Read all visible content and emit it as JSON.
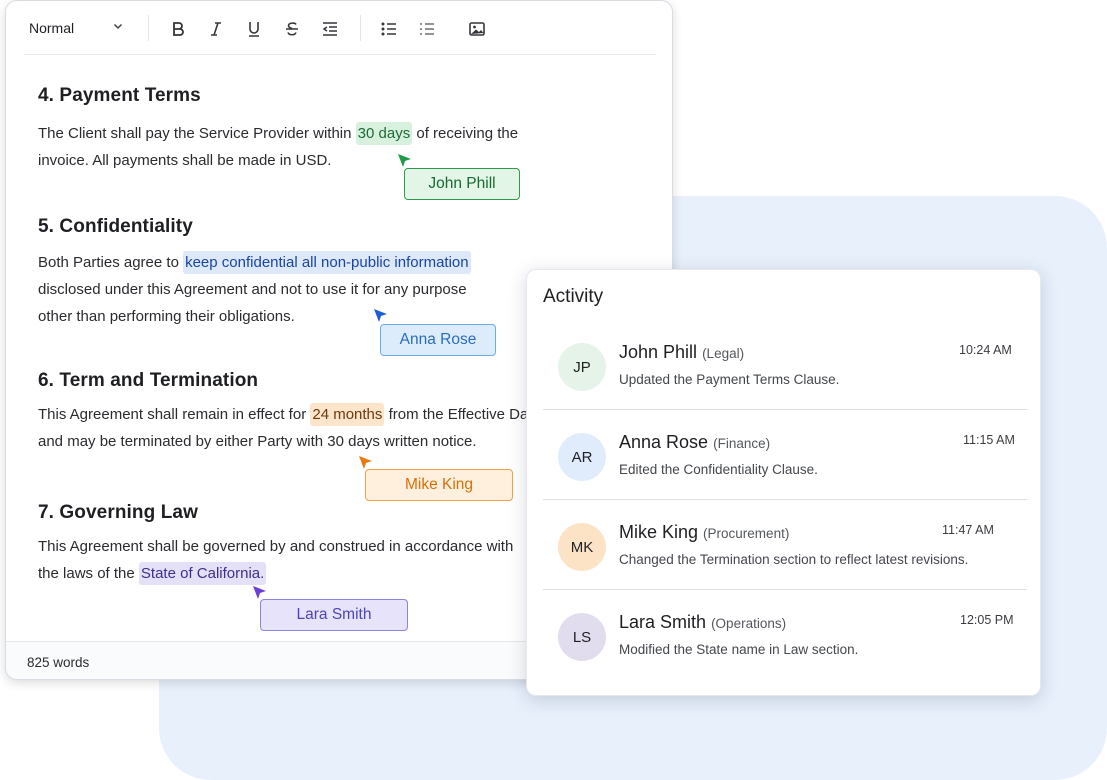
{
  "toolbar": {
    "style_value": "Normal",
    "buttons": [
      "bold-icon",
      "italic-icon",
      "underline-icon",
      "strikethrough-icon",
      "indent-icon",
      "bulleted-list-icon",
      "list-icon",
      "image-icon"
    ]
  },
  "document": {
    "payment": {
      "title": "4. Payment Terms",
      "before": "The Client shall pay the Service Provider within ",
      "highlight": "30 days",
      "after": " of receiving the",
      "line2": "invoice. All payments shall be made in USD."
    },
    "confidentiality": {
      "title": "5. Confidentiality",
      "before": "Both Parties agree to ",
      "highlight": "keep confidential all non-public information",
      "line2": "disclosed under this Agreement and not to use it for any purpose",
      "line3": "other than performing their obligations."
    },
    "term": {
      "title": "6. Term and Termination",
      "before": "This Agreement shall remain in effect for ",
      "highlight": "24 months",
      "after": " from the Effective Date",
      "line2": "and may be terminated by either Party with 30 days written notice."
    },
    "law": {
      "title": "7. Governing Law",
      "line1": "This Agreement shall be governed by and construed in accordance with",
      "before2": "the laws of the ",
      "highlight": "State of California."
    }
  },
  "collaborators": {
    "green": {
      "name": "John Phill",
      "color": "#1f9a47"
    },
    "blue": {
      "name": "Anna Rose",
      "color": "#1a5fd6"
    },
    "orange": {
      "name": "Mike King",
      "color": "#ea7a12"
    },
    "purple": {
      "name": "Lara Smith",
      "color": "#6a3ed8"
    }
  },
  "footer": {
    "word_count": "825 words"
  },
  "activity": {
    "title": "Activity",
    "items": [
      {
        "initials": "JP",
        "name": "John Phill",
        "role": "(Legal)",
        "time": "10:24 AM",
        "desc": "Updated the Payment Terms Clause.",
        "avatar_bg": "#e6f3e8"
      },
      {
        "initials": "AR",
        "name": "Anna Rose",
        "role": "(Finance)",
        "time": "11:15 AM",
        "desc": "Edited the Confidentiality Clause.",
        "avatar_bg": "#e0ecfb"
      },
      {
        "initials": "MK",
        "name": "Mike King",
        "role": "(Procurement)",
        "time": "11:47 AM",
        "desc": "Changed the Termination section to reflect latest revisions.",
        "avatar_bg": "#fde3c6"
      },
      {
        "initials": "LS",
        "name": "Lara Smith",
        "role": "(Operations)",
        "time": "12:05 PM",
        "desc": "Modified the State name in Law section.",
        "avatar_bg": "#e2dcef"
      }
    ]
  }
}
